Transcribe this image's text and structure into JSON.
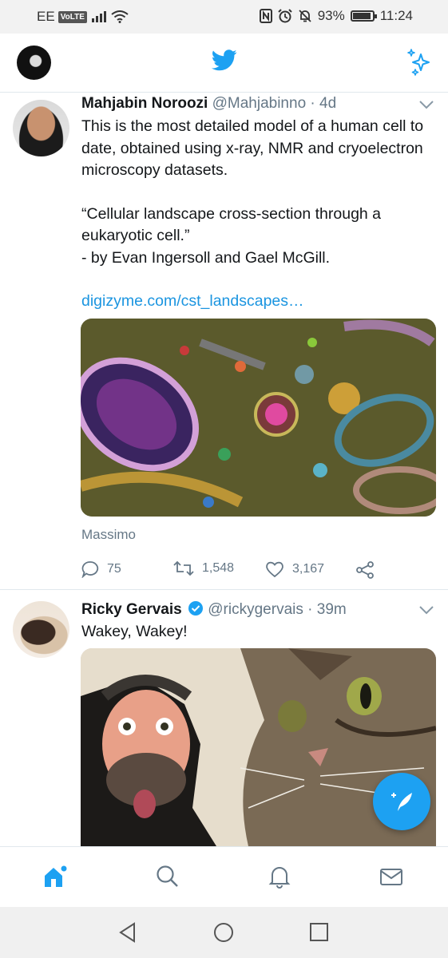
{
  "status_bar": {
    "carrier": "EE",
    "volte": "VoLTE",
    "battery_percent": "93%",
    "battery_level": 0.93,
    "time": "11:24"
  },
  "header": {
    "logo_icon": "twitter-bird-icon",
    "sparkle_icon": "sparkle-icon"
  },
  "tweets": [
    {
      "name": "Mahjabin Noroozi",
      "handle": "@Mahjabinno",
      "time": "· 4d",
      "text_lines": [
        "This is the most detailed model of a human cell to date, obtained using x-ray, NMR and cryoelectron microscopy datasets.",
        "“Cellular landscape cross-section through a eukaryotic cell.”",
        "- by Evan Ingersoll and Gael McGill."
      ],
      "link": "digizyme.com/cst_landscapes…",
      "media_credit": "Massimo",
      "replies": "75",
      "retweets": "1,548",
      "likes": "3,167"
    },
    {
      "name": "Ricky Gervais",
      "handle": "@rickygervais",
      "time": "· 39m",
      "text": "Wakey, Wakey!"
    }
  ],
  "colors": {
    "accent": "#1da1f2",
    "link": "#1b95e0",
    "muted": "#657786",
    "divider": "#e1e8ed"
  }
}
